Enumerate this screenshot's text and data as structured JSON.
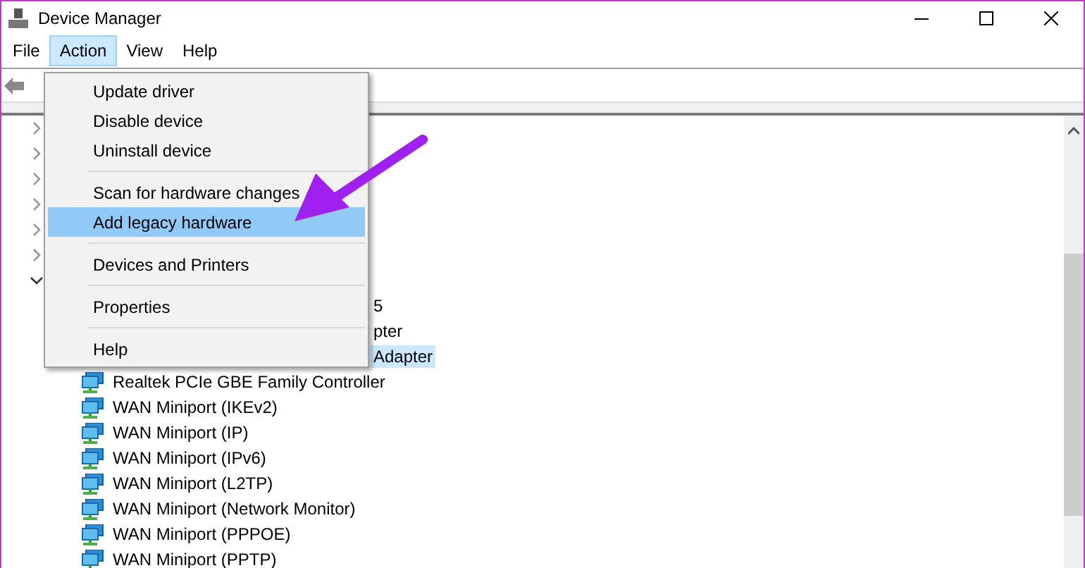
{
  "window": {
    "title": "Device Manager"
  },
  "menu_bar": [
    {
      "label": "File",
      "selected": false
    },
    {
      "label": "Action",
      "selected": true
    },
    {
      "label": "View",
      "selected": false
    },
    {
      "label": "Help",
      "selected": false
    }
  ],
  "tree": [
    {
      "expanded": false
    },
    {
      "expanded": false
    },
    {
      "expanded": false
    },
    {
      "expanded": false
    },
    {
      "expanded": false
    },
    {
      "expanded": false
    },
    {
      "expanded": true,
      "children": [
        {
          "kind": "covered",
          "label": "5",
          "selected": false
        },
        {
          "kind": "covered",
          "label": "pter",
          "selected": false
        },
        {
          "kind": "covered",
          "label": "Adapter",
          "selected": true
        },
        {
          "kind": "device",
          "label": "Realtek PCIe GBE Family Controller",
          "selected": false
        },
        {
          "kind": "device",
          "label": "WAN Miniport (IKEv2)",
          "selected": false
        },
        {
          "kind": "device",
          "label": "WAN Miniport (IP)",
          "selected": false
        },
        {
          "kind": "device",
          "label": "WAN Miniport (IPv6)",
          "selected": false
        },
        {
          "kind": "device",
          "label": "WAN Miniport (L2TP)",
          "selected": false
        },
        {
          "kind": "device",
          "label": "WAN Miniport (Network Monitor)",
          "selected": false
        },
        {
          "kind": "device",
          "label": "WAN Miniport (PPPOE)",
          "selected": false
        },
        {
          "kind": "device",
          "label": "WAN Miniport (PPTP)",
          "selected": false
        }
      ]
    }
  ],
  "action_menu": [
    {
      "kind": "item",
      "label": "Update driver",
      "selected": false
    },
    {
      "kind": "item",
      "label": "Disable device",
      "selected": false
    },
    {
      "kind": "item",
      "label": "Uninstall device",
      "selected": false
    },
    {
      "kind": "separator"
    },
    {
      "kind": "item",
      "label": "Scan for hardware changes",
      "selected": false
    },
    {
      "kind": "item",
      "label": "Add legacy hardware",
      "selected": true
    },
    {
      "kind": "separator"
    },
    {
      "kind": "item",
      "label": "Devices and Printers",
      "selected": false
    },
    {
      "kind": "separator"
    },
    {
      "kind": "item",
      "label": "Properties",
      "selected": false
    },
    {
      "kind": "separator"
    },
    {
      "kind": "item",
      "label": "Help",
      "selected": false
    }
  ]
}
